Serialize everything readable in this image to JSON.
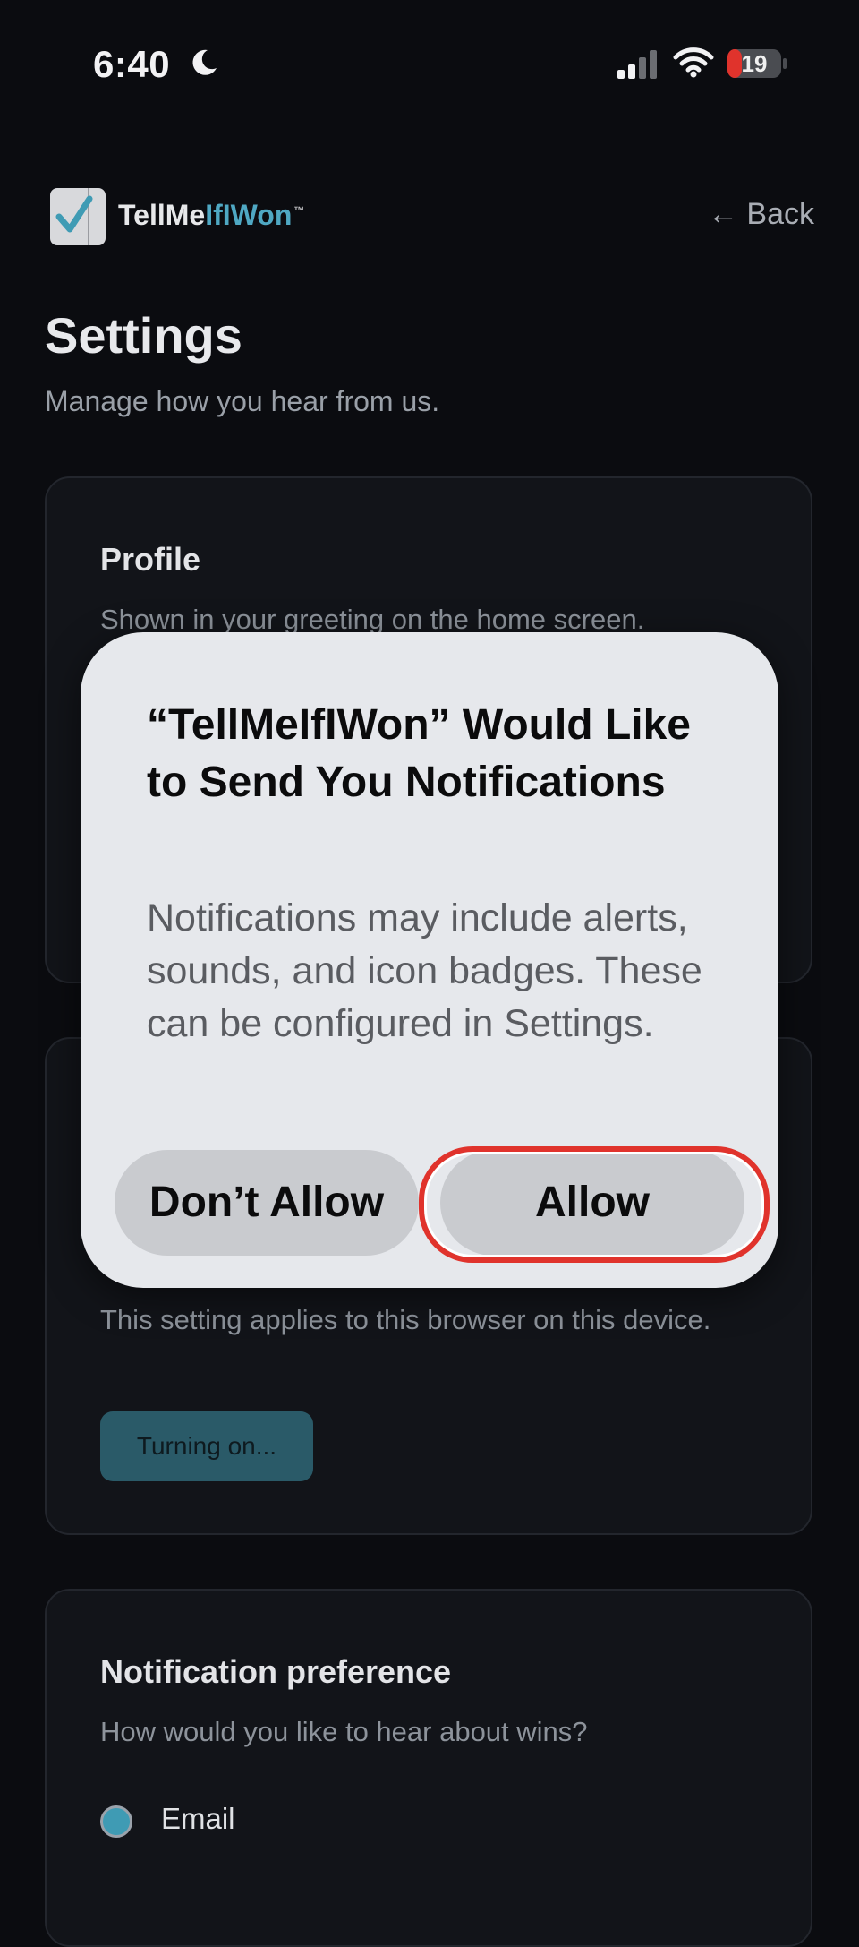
{
  "status_bar": {
    "time": "6:40",
    "battery": "19",
    "icons": [
      "moon-icon",
      "signal-icon",
      "wifi-icon",
      "battery-icon"
    ]
  },
  "header": {
    "brand_part1": "TellMe",
    "brand_part2": "IfIWon",
    "brand_tm": "™",
    "back_label": "← Back"
  },
  "page": {
    "title": "Settings",
    "subtitle": "Manage how you hear from us."
  },
  "cards": {
    "profile": {
      "title": "Profile",
      "text": "Shown in your greeting on the home screen."
    },
    "push": {
      "text": "This setting applies to this browser on this device.",
      "button_label": "Turning on..."
    },
    "notification": {
      "title": "Notification preference",
      "text": "How would you like to hear about wins?",
      "option_label": "Email"
    }
  },
  "alert": {
    "title": "“TellMeIfIWon” Would Like to Send You Notifications",
    "body": "Notifications may include alerts, sounds, and icon badges. These can be configured in Settings.",
    "deny_label": "Don’t Allow",
    "allow_label": "Allow"
  },
  "colors": {
    "accent": "#4fa8c3",
    "background": "#0b0c10",
    "card": "#121419",
    "highlight": "#e0332c"
  }
}
